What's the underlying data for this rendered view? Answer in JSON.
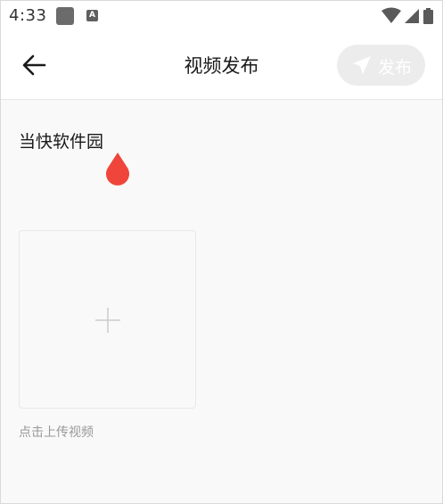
{
  "status_bar": {
    "time": "4:33",
    "a_icon_label": "A",
    "icons": [
      "app-square-icon",
      "a-notification-icon",
      "wifi-icon",
      "signal-icon",
      "battery-icon"
    ]
  },
  "header": {
    "title": "视频发布",
    "publish_label": "发布",
    "back_icon": "arrow-left-icon",
    "publish_icon": "send-icon"
  },
  "caption": {
    "value": "当快软件园"
  },
  "upload": {
    "hint": "点击上传视频",
    "icon": "plus-icon"
  },
  "colors": {
    "accent_handle": "#f0453a",
    "publish_bg_disabled": "#ececec",
    "background": "#f9f9f9"
  }
}
